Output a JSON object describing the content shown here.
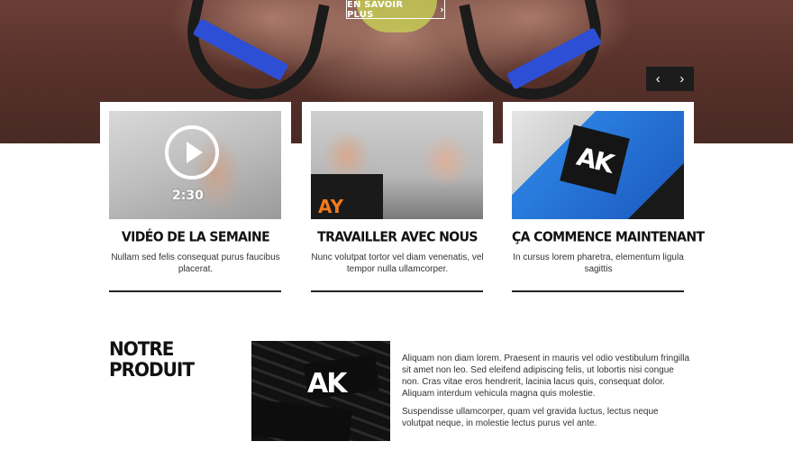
{
  "hero": {
    "cta_label": "EN SAVOIR PLUS",
    "cta_arrow": "›",
    "nav_prev": "‹",
    "nav_next": "›"
  },
  "cards": [
    {
      "title": "VIDÉO DE LA SEMAINE",
      "text": "Nullam sed felis consequat purus faucibus placerat.",
      "duration": "2:30"
    },
    {
      "title": "TRAVAILLER AVEC NOUS",
      "text": "Nunc volutpat tortor vel diam venenatis, vel tempor nulla ullamcorper.",
      "shirt_text": "AY"
    },
    {
      "title": "ÇA COMMENCE MAINTENANT",
      "text": "In cursus lorem pharetra, elementum ligula sagittis",
      "patch_text": "AK"
    }
  ],
  "product": {
    "title_line1": "NOTRE",
    "title_line2": "PRODUIT",
    "image_text": "AK",
    "paragraph1": "Aliquam non diam lorem. Praesent in mauris vel odio vestibulum fringilla sit amet non leo. Sed eleifend adipiscing felis, ut lobortis nisi congue non. Cras vitae eros hendrerit, lacinia lacus quis, consequat dolor. Aliquam interdum vehicula magna quis molestie.",
    "paragraph2": "Suspendisse ullamcorper, quam vel gravida luctus, lectus neque volutpat neque, in molestie lectus purus vel ante."
  }
}
